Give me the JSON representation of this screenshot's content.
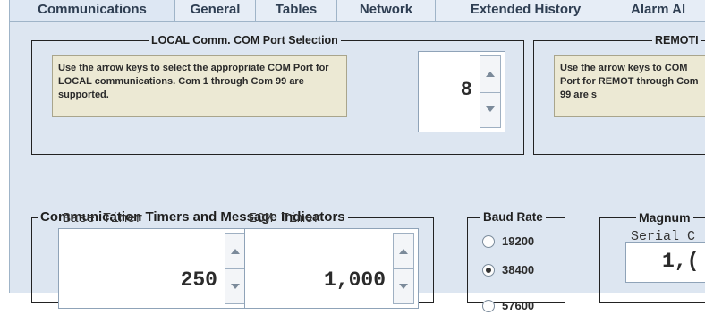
{
  "tabs": [
    {
      "label": "Communications",
      "active": true
    },
    {
      "label": "General",
      "active": false
    },
    {
      "label": "Tables",
      "active": false
    },
    {
      "label": "Network",
      "active": false
    },
    {
      "label": "Extended History",
      "active": false
    },
    {
      "label": "Alarm Al",
      "active": false
    }
  ],
  "local_com": {
    "title": "LOCAL Comm. COM Port Selection",
    "note": "Use the arrow keys to select the appropriate COM Port for LOCAL communications.  Com 1 through Com 99 are supported.",
    "port_value": "8"
  },
  "remote_com": {
    "title": "REMOTI",
    "note": "Use the arrow keys to COM Port for REMOT through Com 99 are s"
  },
  "timers": {
    "title": "Communication Timers and Message Indicators",
    "base_timer": {
      "label": "Base Timer",
      "value": "250"
    },
    "eom_timer": {
      "label": "EOM Timer",
      "value": "1,000"
    }
  },
  "baud_rate": {
    "title": "Baud Rate",
    "options": [
      {
        "label": "19200",
        "selected": false
      },
      {
        "label": "38400",
        "selected": true
      },
      {
        "label": "57600",
        "selected": false
      }
    ]
  },
  "magnum": {
    "title": "Magnum",
    "serial_label": "Serial C",
    "serial_value": "1,("
  },
  "colors": {
    "panel_bg": "#dde6f1",
    "tab_bg": "#e6edf6",
    "note_bg": "#ece9d4",
    "border": "#222222"
  }
}
